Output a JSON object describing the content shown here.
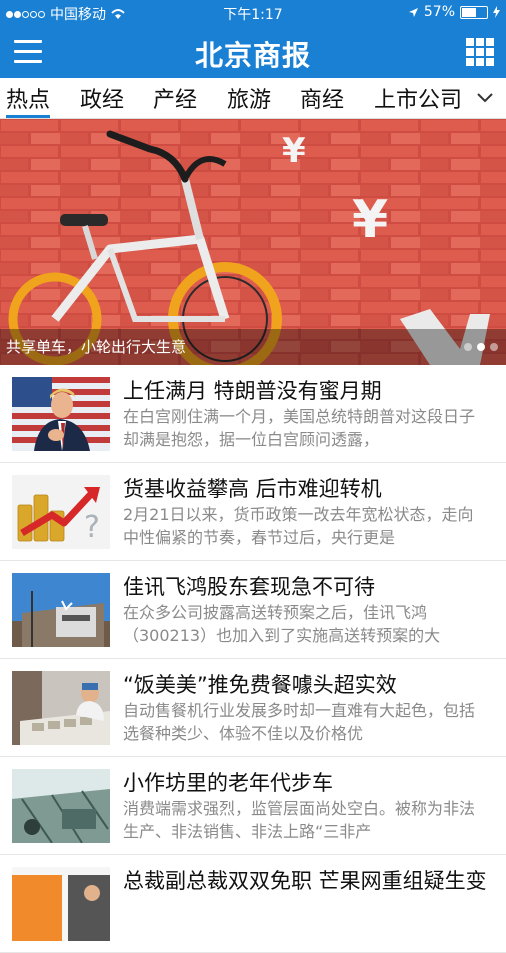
{
  "status": {
    "carrier": "中国移动",
    "time": "下午1:17",
    "battery": "57%",
    "battery_level": 0.57
  },
  "header": {
    "title": "北京商报"
  },
  "tabs": [
    "热点",
    "政经",
    "产经",
    "旅游",
    "商经",
    "上市公司"
  ],
  "banner": {
    "caption": "共享单车，小轮出行大生意",
    "slide_index": 1,
    "slide_count": 3
  },
  "articles": [
    {
      "title": "上任满月 特朗普没有蜜月期",
      "summary": "在白宫刚住满一个月，美国总统特朗普对这段日子却满是抱怨，据一位白宫顾问透露，"
    },
    {
      "title": "货基收益攀高 后市难迎转机",
      "summary": "2月21日以来，货币政策一改去年宽松状态，走向中性偏紧的节奏，春节过后，央行更是"
    },
    {
      "title": "佳讯飞鸿股东套现急不可待",
      "summary": "在众多公司披露高送转预案之后，佳讯飞鸿（300213）也加入到了实施高送转预案的大"
    },
    {
      "title": "“饭美美”推免费餐噱头超实效",
      "summary": "自动售餐机行业发展多时却一直难有大起色，包括选餐种类少、体验不佳以及价格优"
    },
    {
      "title": "小作坊里的老年代步车",
      "summary": "消费端需求强烈，监管层面尚处空白。被称为非法生产、非法销售、非法上路“三非产"
    },
    {
      "title": "总裁副总裁双双免职 芒果网重组疑生变",
      "summary": ""
    }
  ],
  "colors": {
    "brand": "#1a80d4"
  }
}
